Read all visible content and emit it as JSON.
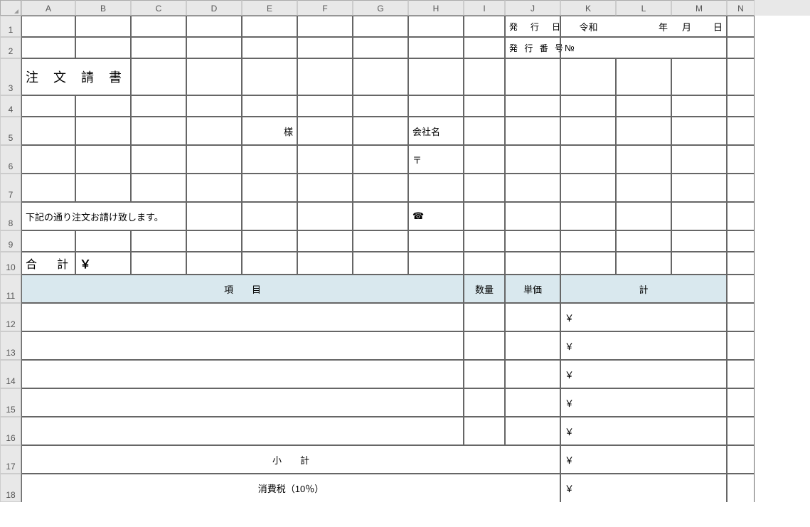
{
  "cols": [
    "",
    "A",
    "B",
    "C",
    "D",
    "E",
    "F",
    "G",
    "H",
    "I",
    "J",
    "K",
    "L",
    "M",
    "N"
  ],
  "rows": [
    "1",
    "2",
    "3",
    "4",
    "5",
    "6",
    "7",
    "8",
    "9",
    "10",
    "11",
    "12",
    "13",
    "14",
    "15",
    "16",
    "17",
    "18"
  ],
  "r1": {
    "issuedate": "発　行　日",
    "era": "令和",
    "year": "年",
    "month": "月",
    "day": "日"
  },
  "r2": {
    "issuenum": "発 行 番 号",
    "no": "№"
  },
  "r3": {
    "title": "注 文 請 書"
  },
  "r5": {
    "sama": "様",
    "company": "会社名"
  },
  "r6": {
    "postal": "〒"
  },
  "r8": {
    "note": "下記の通り注文お請け致します。",
    "tel": "☎"
  },
  "r10": {
    "total": "合　計",
    "yen": "￥"
  },
  "r11": {
    "item": "項　　目",
    "qty": "数量",
    "unitprice": "単価",
    "subtotal": "計"
  },
  "r12": {
    "yen": "￥"
  },
  "r13": {
    "yen": "￥"
  },
  "r14": {
    "yen": "￥"
  },
  "r15": {
    "yen": "￥"
  },
  "r16": {
    "yen": "￥"
  },
  "r17": {
    "label": "小　　計",
    "yen": "￥"
  },
  "r18": {
    "label": "消費税（10％）",
    "yen": "￥"
  }
}
